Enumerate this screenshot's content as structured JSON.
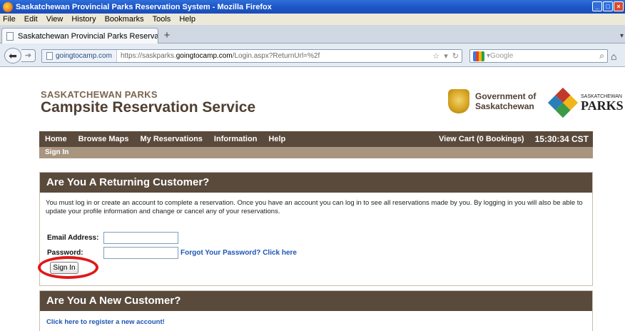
{
  "window": {
    "title": "Saskatchewan Provincial Parks Reservation System - Mozilla Firefox",
    "controls": [
      "minimize",
      "maximize",
      "close"
    ]
  },
  "menu": [
    "File",
    "Edit",
    "View",
    "History",
    "Bookmarks",
    "Tools",
    "Help"
  ],
  "tabs": [
    {
      "label": "Saskatchewan Provincial Parks Reservation ...",
      "active": true
    }
  ],
  "newtab_label": "+",
  "navbar": {
    "site_identity": "goingtocamp.com",
    "url_prefix": "https://saskparks.",
    "url_domain": "goingtocamp.com",
    "url_path": "/Login.aspx?ReturnUrl=%2f",
    "search_placeholder": "Google"
  },
  "site": {
    "brand_small": "SASKATCHEWAN PARKS",
    "brand_big": "Campsite Reservation Service",
    "gov_line1": "Government of",
    "gov_line2": "Saskatchewan",
    "parks_small": "SASKATCHEWAN",
    "parks_big": "PARKS"
  },
  "mainnav": {
    "links": [
      "Home",
      "Browse Maps",
      "My Reservations",
      "Information",
      "Help"
    ],
    "cart": "View Cart (0 Bookings)",
    "clock": "15:30:34 CST"
  },
  "subnav": "Sign In",
  "returning": {
    "heading": "Are You A Returning Customer?",
    "intro": "You must log in or create an account to complete a reservation. Once you have an account you can log in to see all reservations made by you. By logging in you will also be able to update your profile information and change or cancel any of your reservations.",
    "email_label": "Email Address:",
    "email_value": "",
    "password_label": "Password:",
    "password_value": "",
    "forgot": "Forgot Your Password? Click here",
    "signin": "Sign In"
  },
  "new_customer": {
    "heading": "Are You A New Customer?",
    "register": "Click here to register a new account!"
  },
  "colors": {
    "nav_brown": "#5a4a3c",
    "subnav_tan": "#a79580",
    "link_blue": "#1c55b2",
    "highlight_red": "#e01818"
  }
}
